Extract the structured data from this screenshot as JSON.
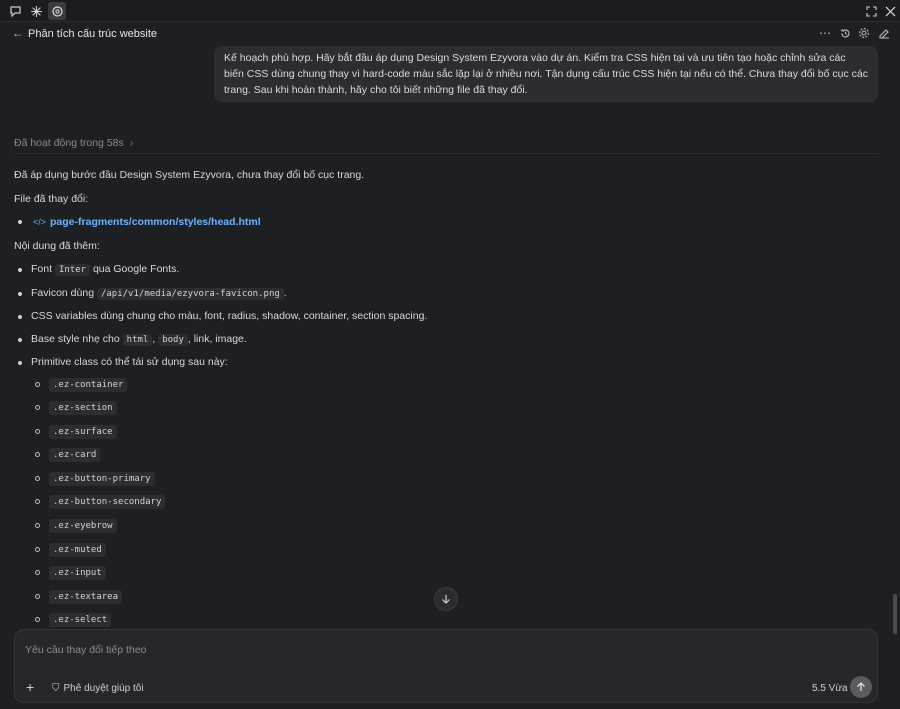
{
  "window": {
    "title": "Phân tích cấu trúc website",
    "restore_icon": "restore-icon",
    "close_icon": "close-icon"
  },
  "user_message": "Kế hoạch phù hợp. Hãy bắt đầu áp dụng Design System Ezyvora vào dự án. Kiểm tra CSS hiện tại và ưu tiên tạo hoặc chỉnh sửa các biến CSS dùng chung thay vì hard-code màu sắc lặp lại ở nhiều nơi. Tận dụng cấu trúc CSS hiện tại nếu có thể. Chưa thay đổi bố cục các trang. Sau khi hoàn thành, hãy cho tôi biết những file đã thay đổi.",
  "activity": "Đã hoạt động trong 58s",
  "response": {
    "summary": "Đã áp dụng bước đầu Design System Ezyvora, chưa thay đổi bố cục trang.",
    "files_heading": "File đã thay đổi:",
    "file_link": "page-fragments/common/styles/head.html",
    "content_heading": "Nội dung đã thêm:",
    "item_font": {
      "pre": "Font",
      "code": "Inter",
      "post": "qua Google Fonts."
    },
    "item_favicon": {
      "pre": "Favicon dùng",
      "code": "/api/v1/media/ezyvora-favicon.png",
      "post": "."
    },
    "item_vars": "CSS variables dùng chung cho màu, font, radius, shadow, container, section spacing.",
    "item_base": {
      "pre": "Base style nhẹ cho",
      "code1": "html",
      "sep": ",",
      "code2": "body",
      "post": ", link, image."
    },
    "item_primitive": "Primitive class có thể tái sử dụng sau này:",
    "classes": [
      ".ez-container",
      ".ez-section",
      ".ez-surface",
      ".ez-card",
      ".ez-button-primary",
      ".ez-button-secondary",
      ".ez-eyebrow",
      ".ez-muted",
      ".ez-input",
      ".ez-textarea",
      ".ez-select"
    ]
  },
  "composer": {
    "placeholder": "Yêu cầu thay đổi tiếp theo",
    "approval": "Phê duyệt giúp tôi",
    "model": "5.5  Vừa"
  }
}
